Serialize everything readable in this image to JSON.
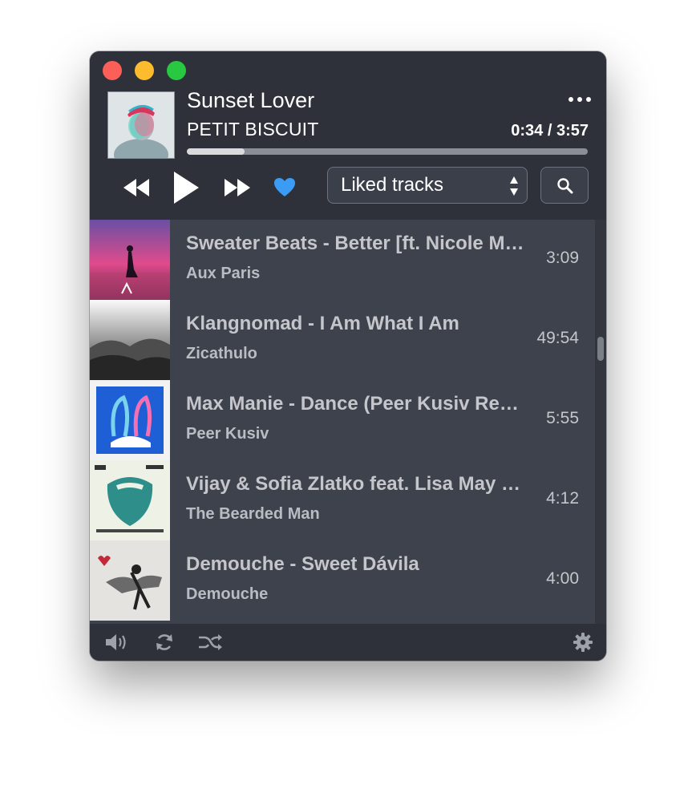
{
  "window": {
    "controls": [
      "close",
      "minimize",
      "maximize"
    ]
  },
  "now_playing": {
    "title": "Sunset Lover",
    "artist": "PETIT BISCUIT",
    "time": "0:34 / 3:57",
    "progress_fraction": 0.143,
    "more_icon": "ellipsis-icon"
  },
  "transport": {
    "rewind_icon": "rewind-icon",
    "play_icon": "play-icon",
    "fast_forward_icon": "fast-forward-icon",
    "like_icon": "heart-icon"
  },
  "playlist_select": {
    "selected": "Liked tracks"
  },
  "search": {
    "icon": "search-icon"
  },
  "tracks": [
    {
      "title": "Sweater Beats - Better [ft. Nicole Millar]",
      "artist": "Aux Paris",
      "duration": "3:09"
    },
    {
      "title": "Klangnomad - I Am What I Am",
      "artist": "Zicathulo",
      "duration": "49:54"
    },
    {
      "title": "Max Manie - Dance (Peer Kusiv Remix)",
      "artist": "Peer Kusiv",
      "duration": "5:55"
    },
    {
      "title": "Vijay & Sofia Zlatko feat. Lisa May - Are You Magic",
      "artist": "The Bearded Man",
      "duration": "4:12"
    },
    {
      "title": "Demouche - Sweet Dávila",
      "artist": "Demouche",
      "duration": "4:00"
    }
  ],
  "footer": {
    "volume_icon": "volume-icon",
    "repeat_icon": "repeat-icon",
    "shuffle_icon": "shuffle-icon",
    "settings_icon": "gear-icon"
  },
  "colors": {
    "accent": "#3b9cf5",
    "header_bg": "#2e3139",
    "list_bg": "#3e424c"
  }
}
